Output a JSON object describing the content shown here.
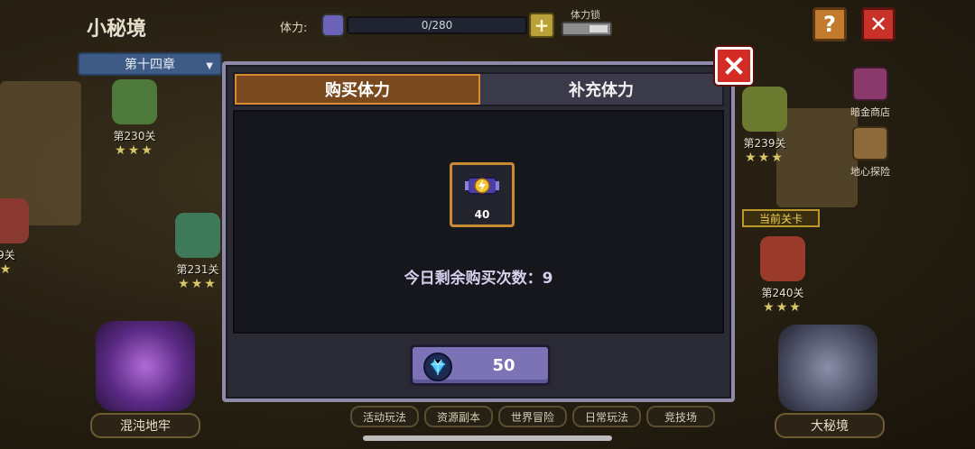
{
  "header": {
    "title": "小秘境",
    "chapter": "第十四章",
    "stamina_label": "体力:",
    "stamina_value": "0/280",
    "stamina_plus": "+",
    "lock_label": "体力锁",
    "help": "?"
  },
  "side_menu": [
    {
      "label": "暗金商店",
      "icon": "shop-chest-icon"
    },
    {
      "label": "地心探险",
      "icon": "crystal-mine-icon"
    }
  ],
  "levels": [
    {
      "label": "第230关",
      "stars": "★★★"
    },
    {
      "label": "9关",
      "stars": "★"
    },
    {
      "label": "第231关",
      "stars": "★★★"
    },
    {
      "label": "第239关",
      "stars": "★★★"
    },
    {
      "label": "第240关",
      "stars": "★★★"
    }
  ],
  "current_level_badge": "当前关卡",
  "bottom": {
    "left_portal": "混沌地牢",
    "right_portal": "大秘境",
    "tabs": [
      "活动玩法",
      "资源副本",
      "世界冒险",
      "日常玩法",
      "竞技场"
    ]
  },
  "modal": {
    "tabs": [
      {
        "label": "购买体力",
        "active": true
      },
      {
        "label": "补充体力",
        "active": false
      }
    ],
    "item_quantity": "40",
    "remaining_text": "今日剩余购买次数：9",
    "price": "50",
    "colors": {
      "accent": "#d88b2e",
      "close": "#d42c25",
      "button": "#7b73b6"
    }
  }
}
